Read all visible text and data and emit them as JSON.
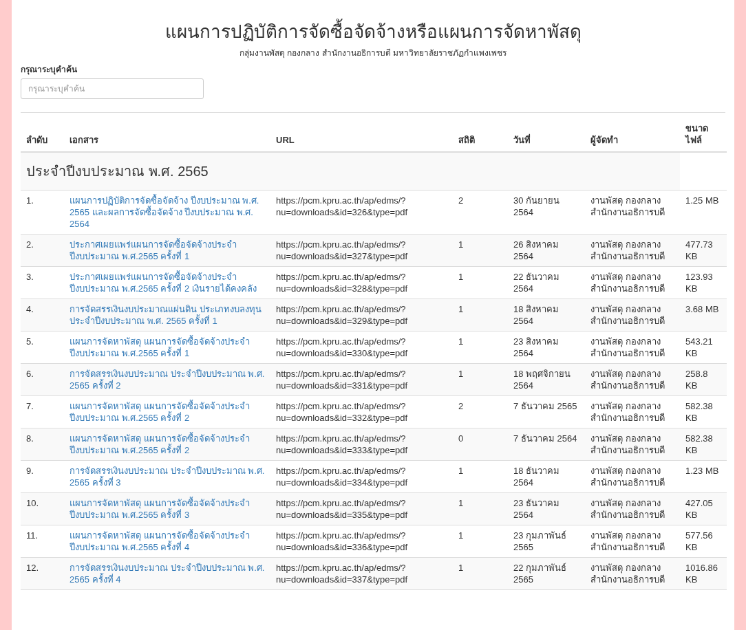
{
  "title": "แผนการปฏิบัติการจัดซื้อจัดจ้างหรือแผนการจัดหาพัสดุ",
  "subtitle": "กลุ่มงานพัสดุ กองกลาง สำนักงานอธิการบดี มหาวิทยาลัยราชภัฏกำแพงเพชร",
  "search": {
    "label": "กรุณาระบุคำค้น",
    "placeholder": "กรุณาระบุคำค้น"
  },
  "table": {
    "columns": [
      "ลำดับ",
      "เอกสาร",
      "URL",
      "สถิติ",
      "วันที่",
      "ผู้จัดทำ",
      "ขนาดไฟล์"
    ],
    "group": "ประจำปีงบประมาณ พ.ศ. 2565",
    "rows": [
      {
        "no": "1.",
        "document": "แผนการปฏิบัติการจัดซื้อจัดจ้าง ปีงบประมาณ พ.ศ. 2565 และผลการจัดซื้อจัดจ้าง ปีงบประมาณ พ.ศ. 2564",
        "url": "https://pcm.kpru.ac.th/ap/edms/?nu=downloads&id=326&type=pdf",
        "stats": "2",
        "date": "30 กันยายน 2564",
        "author": "งานพัสดุ กองกลาง สำนักงานอธิการบดี",
        "size": "1.25 MB"
      },
      {
        "no": "2.",
        "document": "ประกาศเผยแพร่แผนการจัดซื้อจัดจ้างประจำปีงบประมาณ พ.ศ.2565 ครั้งที่ 1",
        "url": "https://pcm.kpru.ac.th/ap/edms/?nu=downloads&id=327&type=pdf",
        "stats": "1",
        "date": "26 สิงหาคม 2564",
        "author": "งานพัสดุ กองกลาง สำนักงานอธิการบดี",
        "size": "477.73 KB"
      },
      {
        "no": "3.",
        "document": "ประกาศเผยแพร่แผนการจัดซื้อจัดจ้างประจำปีงบประมาณ พ.ศ.2565 ครั้งที่ 2 เงินรายได้คงคลัง",
        "url": "https://pcm.kpru.ac.th/ap/edms/?nu=downloads&id=328&type=pdf",
        "stats": "1",
        "date": "22 ธันวาคม 2564",
        "author": "งานพัสดุ กองกลาง สำนักงานอธิการบดี",
        "size": "123.93 KB"
      },
      {
        "no": "4.",
        "document": "การจัดสรรเงินงบประมาณแผ่นดิน ประเภทงบลงทุน ประจำปีงบประมาณ พ.ศ. 2565 ครั้งที่ 1",
        "url": "https://pcm.kpru.ac.th/ap/edms/?nu=downloads&id=329&type=pdf",
        "stats": "1",
        "date": "18 สิงหาคม 2564",
        "author": "งานพัสดุ กองกลาง สำนักงานอธิการบดี",
        "size": "3.68 MB"
      },
      {
        "no": "5.",
        "document": "แผนการจัดหาพัสดุ แผนการจัดซื้อจัดจ้างประจำปีงบประมาณ พ.ศ.2565 ครั้งที่ 1",
        "url": "https://pcm.kpru.ac.th/ap/edms/?nu=downloads&id=330&type=pdf",
        "stats": "1",
        "date": "23 สิงหาคม 2564",
        "author": "งานพัสดุ กองกลาง สำนักงานอธิการบดี",
        "size": "543.21 KB"
      },
      {
        "no": "6.",
        "document": "การจัดสรรเงินงบประมาณ ประจำปีงบประมาณ พ.ศ. 2565 ครั้งที่ 2",
        "url": "https://pcm.kpru.ac.th/ap/edms/?nu=downloads&id=331&type=pdf",
        "stats": "1",
        "date": "18 พฤศจิกายน 2564",
        "author": "งานพัสดุ กองกลาง สำนักงานอธิการบดี",
        "size": "258.8 KB"
      },
      {
        "no": "7.",
        "document": "แผนการจัดหาพัสดุ แผนการจัดซื้อจัดจ้างประจำปีงบประมาณ พ.ศ.2565 ครั้งที่ 2",
        "url": "https://pcm.kpru.ac.th/ap/edms/?nu=downloads&id=332&type=pdf",
        "stats": "2",
        "date": "7 ธันวาคม 2565",
        "author": "งานพัสดุ กองกลาง สำนักงานอธิการบดี",
        "size": "582.38 KB"
      },
      {
        "no": "8.",
        "document": "แผนการจัดหาพัสดุ แผนการจัดซื้อจัดจ้างประจำปีงบประมาณ พ.ศ.2565 ครั้งที่ 2",
        "url": "https://pcm.kpru.ac.th/ap/edms/?nu=downloads&id=333&type=pdf",
        "stats": "0",
        "date": "7 ธันวาคม 2564",
        "author": "งานพัสดุ กองกลาง สำนักงานอธิการบดี",
        "size": "582.38 KB"
      },
      {
        "no": "9.",
        "document": "การจัดสรรเงินงบประมาณ ประจำปีงบประมาณ พ.ศ. 2565 ครั้งที่ 3",
        "url": "https://pcm.kpru.ac.th/ap/edms/?nu=downloads&id=334&type=pdf",
        "stats": "1",
        "date": "18 ธันวาคม 2564",
        "author": "งานพัสดุ กองกลาง สำนักงานอธิการบดี",
        "size": "1.23 MB"
      },
      {
        "no": "10.",
        "document": "แผนการจัดหาพัสดุ แผนการจัดซื้อจัดจ้างประจำปีงบประมาณ พ.ศ.2565 ครั้งที่ 3",
        "url": "https://pcm.kpru.ac.th/ap/edms/?nu=downloads&id=335&type=pdf",
        "stats": "1",
        "date": "23 ธันวาคม 2564",
        "author": "งานพัสดุ กองกลาง สำนักงานอธิการบดี",
        "size": "427.05 KB"
      },
      {
        "no": "11.",
        "document": "แผนการจัดหาพัสดุ แผนการจัดซื้อจัดจ้างประจำปีงบประมาณ พ.ศ.2565 ครั้งที่ 4",
        "url": "https://pcm.kpru.ac.th/ap/edms/?nu=downloads&id=336&type=pdf",
        "stats": "1",
        "date": "23 กุมภาพันธ์ 2565",
        "author": "งานพัสดุ กองกลาง สำนักงานอธิการบดี",
        "size": "577.56 KB"
      },
      {
        "no": "12.",
        "document": "การจัดสรรเงินงบประมาณ ประจำปีงบประมาณ พ.ศ. 2565 ครั้งที่ 4",
        "url": "https://pcm.kpru.ac.th/ap/edms/?nu=downloads&id=337&type=pdf",
        "stats": "1",
        "date": "22 กุมภาพันธ์ 2565",
        "author": "งานพัสดุ กองกลาง สำนักงานอธิการบดี",
        "size": "1016.86 KB"
      }
    ]
  }
}
